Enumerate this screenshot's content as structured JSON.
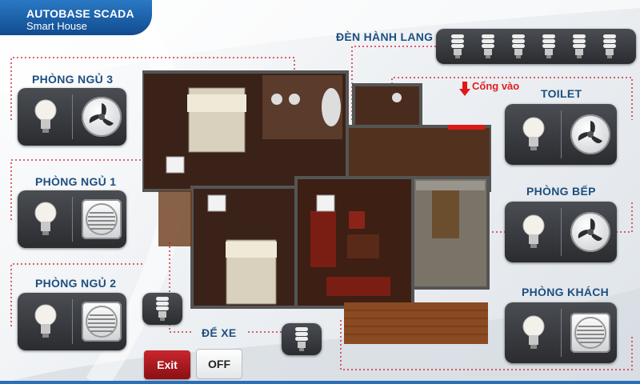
{
  "header": {
    "title": "AUTOBASE SCADA",
    "subtitle": "Smart House"
  },
  "rooms": {
    "bedroom3": {
      "label": "PHÒNG NGỦ 3"
    },
    "bedroom1": {
      "label": "PHÒNG NGỦ 1"
    },
    "bedroom2": {
      "label": "PHÒNG NGỦ 2"
    },
    "hallway": {
      "label": "ĐÈN HÀNH LANG"
    },
    "toilet": {
      "label": "TOILET"
    },
    "kitchen": {
      "label": "PHÒNG BẾP"
    },
    "living": {
      "label": "PHÒNG KHÁCH"
    },
    "garage": {
      "label": "ĐỂ XE"
    }
  },
  "entrance": {
    "label": "Cổng vào"
  },
  "controls": {
    "exit_label": "Exit",
    "off_label": "OFF"
  },
  "colors": {
    "header": "#1a5ea8",
    "label": "#1d4f80",
    "wire": "#d0303a",
    "exit": "#b81d22"
  },
  "icons": [
    "lightbulb-icon",
    "fan-icon",
    "vent-icon",
    "cfl-bulb-icon",
    "arrow-down-icon"
  ]
}
